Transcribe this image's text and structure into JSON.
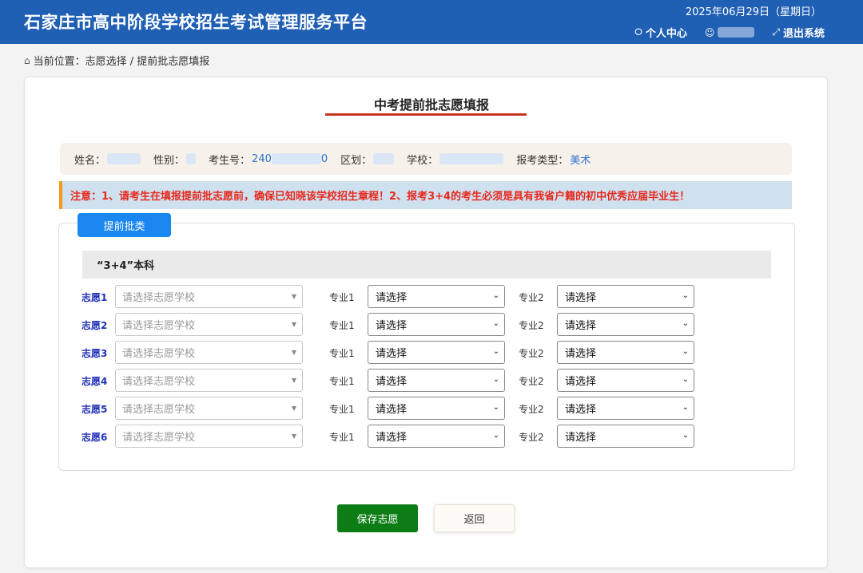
{
  "header": {
    "title": "石家庄市高中阶段学校招生考试管理服务平台",
    "date": "2025年06月29日（星期日）",
    "nav": {
      "profile_icon": "tag-icon",
      "profile_label": "个人中心",
      "user_icon": "user-icon",
      "logout_icon": "exit-icon",
      "logout_label": "退出系统"
    }
  },
  "breadcrumb": {
    "icon": "home-icon",
    "prefix": "当前位置：",
    "path": "志愿选择 / 提前批志愿填报"
  },
  "page": {
    "title": "中考提前批志愿填报"
  },
  "student_info": {
    "name_label": "姓名：",
    "gender_label": "性别：",
    "exam_no_label": "考生号：",
    "exam_no_prefix": "240",
    "exam_no_suffix": "0",
    "district_label": "区划：",
    "school_label": "学校：",
    "type_label": "报考类型：",
    "type_value": "美术"
  },
  "notice": "注意：1、请考生在填报提前批志愿前，确保已知晓该学校招生章程！2、报考3+4的考生必须是具有我省户籍的初中优秀应届毕业生！",
  "tab": {
    "label": "提前批类"
  },
  "category": "“3+4”本科",
  "choices": [
    {
      "label": "志愿1",
      "school_placeholder": "请选择志愿学校",
      "major1_label": "专业1",
      "major1_value": "请选择",
      "major2_label": "专业2",
      "major2_value": "请选择"
    },
    {
      "label": "志愿2",
      "school_placeholder": "请选择志愿学校",
      "major1_label": "专业1",
      "major1_value": "请选择",
      "major2_label": "专业2",
      "major2_value": "请选择"
    },
    {
      "label": "志愿3",
      "school_placeholder": "请选择志愿学校",
      "major1_label": "专业1",
      "major1_value": "请选择",
      "major2_label": "专业2",
      "major2_value": "请选择"
    },
    {
      "label": "志愿4",
      "school_placeholder": "请选择志愿学校",
      "major1_label": "专业1",
      "major1_value": "请选择",
      "major2_label": "专业2",
      "major2_value": "请选择"
    },
    {
      "label": "志愿5",
      "school_placeholder": "请选择志愿学校",
      "major1_label": "专业1",
      "major1_value": "请选择",
      "major2_label": "专业2",
      "major2_value": "请选择"
    },
    {
      "label": "志愿6",
      "school_placeholder": "请选择志愿学校",
      "major1_label": "专业1",
      "major1_value": "请选择",
      "major2_label": "专业2",
      "major2_value": "请选择"
    }
  ],
  "buttons": {
    "save": "保存志愿",
    "back": "返回"
  },
  "colors": {
    "header_bg": "#1f5fb4",
    "accent_blue": "#1a86f0",
    "notice_red": "#e8291d",
    "save_green": "#0b7d14",
    "title_underline": "#c9331c"
  }
}
